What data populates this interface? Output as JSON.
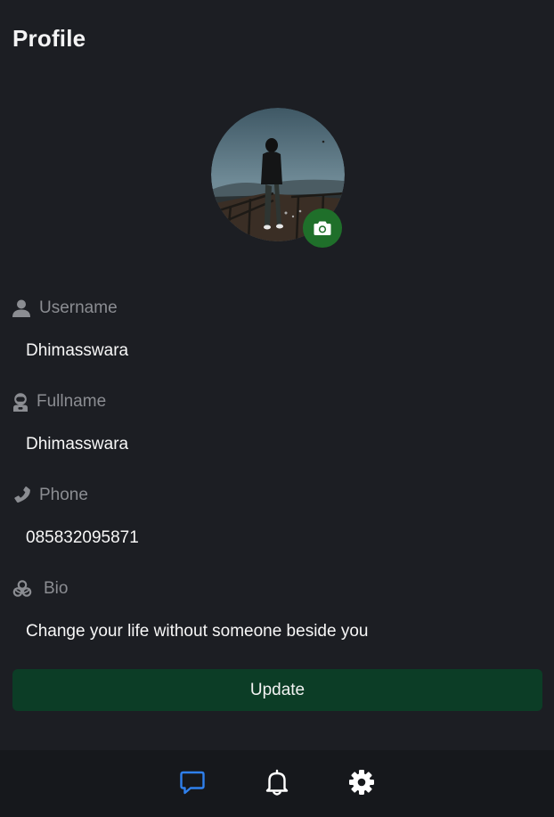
{
  "header": {
    "title": "Profile"
  },
  "profile": {
    "avatar_alt": "Profile photo",
    "fields": [
      {
        "icon": "user-icon",
        "label": "Username",
        "value": "Dhimasswara"
      },
      {
        "icon": "astronaut-icon",
        "label": "Fullname",
        "value": "Dhimasswara"
      },
      {
        "icon": "phone-icon",
        "label": "Phone",
        "value": "085832095871"
      },
      {
        "icon": "biohazard-icon",
        "label": "Bio",
        "value": "Change your life without someone beside you"
      }
    ],
    "update_label": "Update"
  },
  "bottom_nav": {
    "items": [
      {
        "icon": "chat-icon",
        "active": true
      },
      {
        "icon": "bell-icon",
        "active": false
      },
      {
        "icon": "gear-icon",
        "active": false
      }
    ]
  },
  "colors": {
    "background": "#1c1e23",
    "nav_background": "#16181c",
    "accent_green": "#1f6f2a",
    "button_green": "#0c3d26",
    "active_nav": "#2f80ed",
    "label_gray": "#8b8d92"
  }
}
